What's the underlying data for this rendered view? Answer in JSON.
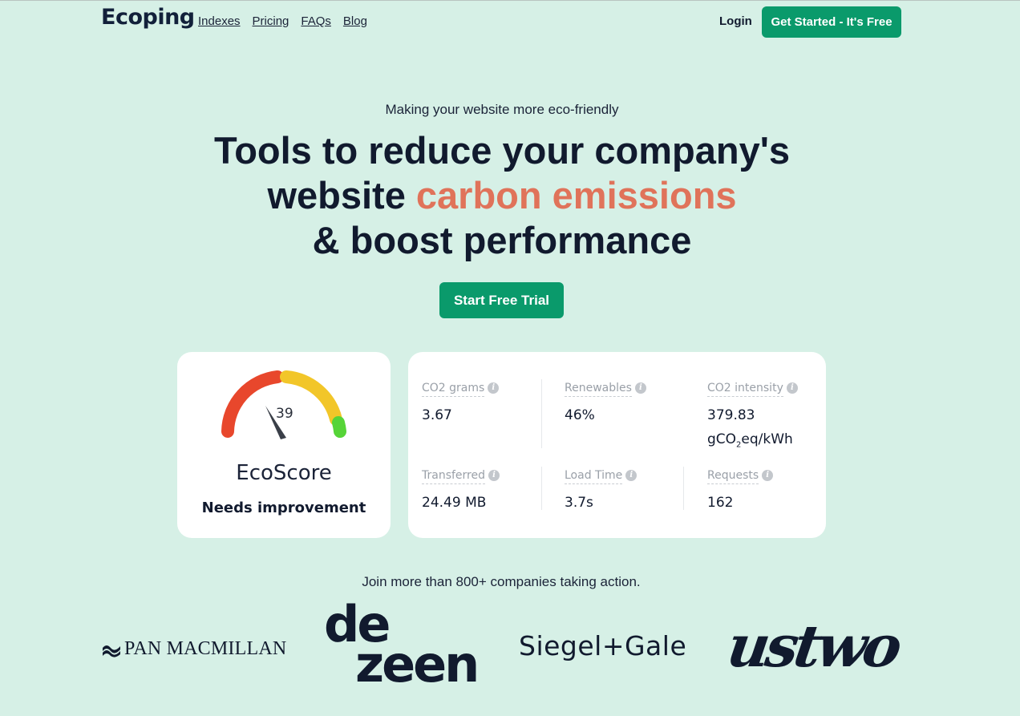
{
  "nav": {
    "logo": "Ecoping",
    "links": [
      "Indexes",
      "Pricing",
      "FAQs",
      "Blog"
    ],
    "login": "Login",
    "get_started": "Get Started - It's Free"
  },
  "hero": {
    "eyebrow": "Making your website more eco-friendly",
    "headline_line1": "Tools to reduce your company's",
    "headline_line2_prefix": "website ",
    "headline_line2_accent": "carbon emissions",
    "headline_line3": "& boost performance",
    "cta": "Start Free Trial"
  },
  "score": {
    "value": "39",
    "label": "EcoScore",
    "status": "Needs improvement"
  },
  "metrics": [
    {
      "label": "CO2 grams",
      "value": "3.67"
    },
    {
      "label": "Renewables",
      "value": "46%"
    },
    {
      "label": "CO2 intensity",
      "value": "379.83",
      "unit_prefix": "gCO",
      "unit_sub": "2",
      "unit_suffix": "eq/kWh"
    },
    {
      "label": "Transferred",
      "value": "24.49 MB"
    },
    {
      "label": "Load Time",
      "value": "3.7s"
    },
    {
      "label": "Requests",
      "value": "162"
    }
  ],
  "social": {
    "join": "Join more than 800+ companies taking action.",
    "logos": {
      "pan": "PAN MACMILLAN",
      "dezeen_1": "de",
      "dezeen_2": "zeen",
      "siegel": "Siegel+Gale",
      "ustwo": "ustwo"
    }
  },
  "colors": {
    "background": "#d6f0e6",
    "brand_green": "#0a9a6b",
    "accent": "#e0735a",
    "gauge_red": "#e8472c",
    "gauge_yellow": "#f2c629",
    "gauge_green": "#56d438"
  }
}
